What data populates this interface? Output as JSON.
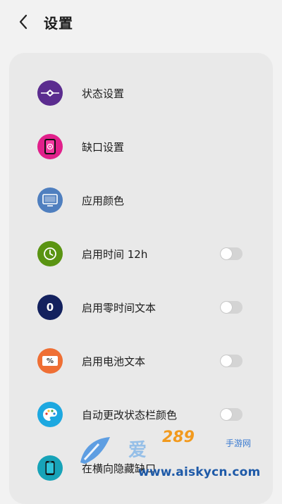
{
  "header": {
    "title": "设置"
  },
  "items": [
    {
      "label": "状态设置",
      "icon": "status-settings-icon",
      "color": "#5b2c8f",
      "toggle": null
    },
    {
      "label": "缺口设置",
      "icon": "notch-settings-icon",
      "color": "#e1208b",
      "toggle": null
    },
    {
      "label": "应用颜色",
      "icon": "monitor-icon",
      "color": "#4f7fbf",
      "toggle": null
    },
    {
      "label": "启用时间 12h",
      "icon": "clock-icon",
      "color": "#5a9412",
      "toggle": false
    },
    {
      "label": "启用零时间文本",
      "icon": "zero-icon",
      "color": "#13215e",
      "toggle": false
    },
    {
      "label": "启用电池文本",
      "icon": "battery-percent-icon",
      "color": "#ef6f34",
      "toggle": false
    },
    {
      "label": "自动更改状态栏颜色",
      "icon": "palette-icon",
      "color": "#1da8e0",
      "toggle": false
    },
    {
      "label": "在横向隐藏缺口",
      "icon": "phone-icon",
      "color": "#17a3b8",
      "toggle": null
    }
  ],
  "icon_glyphs": {
    "zero": "0",
    "percent": "%"
  },
  "watermark": {
    "brand": "爱",
    "number": "289",
    "suffix": "手游网",
    "url": "www.aiskycn.com"
  }
}
